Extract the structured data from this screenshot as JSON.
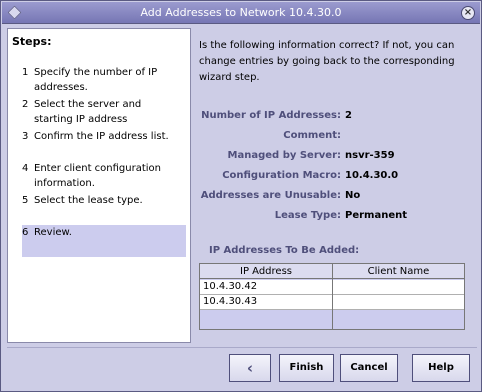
{
  "window": {
    "title": "Add Addresses to Network 10.4.30.0",
    "close_glyph": "×"
  },
  "steps": {
    "heading": "Steps:",
    "items": [
      {
        "num": "1",
        "label": "Specify the number of IP addresses."
      },
      {
        "num": "2",
        "label": "Select the server and starting IP address"
      },
      {
        "num": "3",
        "label": "Confirm the IP address list."
      },
      {
        "num": "4",
        "label": "Enter client configuration information."
      },
      {
        "num": "5",
        "label": "Select the lease type."
      },
      {
        "num": "6",
        "label": "Review."
      }
    ],
    "active_index": 5
  },
  "main": {
    "intro": "Is the following information correct? If not, you can change entries by going back to the corresponding wizard step.",
    "fields": [
      {
        "label": "Number of IP Addresses:",
        "value": "2"
      },
      {
        "label": "Comment:",
        "value": ""
      },
      {
        "label": "Managed by Server:",
        "value": "nsvr-359"
      },
      {
        "label": "Configuration Macro:",
        "value": "10.4.30.0"
      },
      {
        "label": "Addresses are Unusable:",
        "value": "No"
      },
      {
        "label": "Lease Type:",
        "value": "Permanent"
      }
    ],
    "table_heading": "IP Addresses To Be Added:",
    "table_columns": [
      "IP Address",
      "Client Name"
    ],
    "table_rows": [
      [
        "10.4.30.42",
        ""
      ],
      [
        "10.4.30.43",
        ""
      ]
    ]
  },
  "buttons": {
    "back_glyph": "‹",
    "finish": "Finish",
    "cancel": "Cancel",
    "help": "Help"
  }
}
